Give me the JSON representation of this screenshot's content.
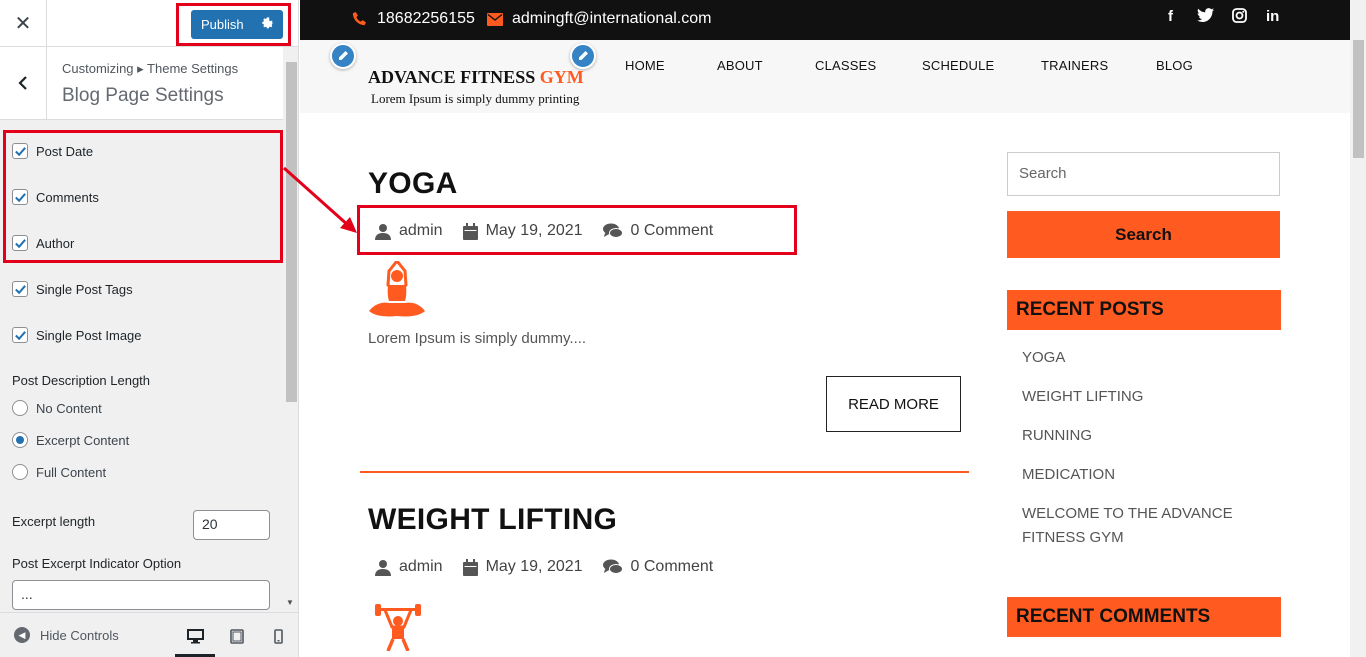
{
  "customizer": {
    "close_icon": "close-icon",
    "publish_label": "Publish",
    "breadcrumb": "Customizing ▸ Theme Settings",
    "section_title": "Blog Page Settings",
    "checkboxes": [
      {
        "label": "Post Date",
        "checked": true
      },
      {
        "label": "Comments",
        "checked": true
      },
      {
        "label": "Author",
        "checked": true
      },
      {
        "label": "Single Post Tags",
        "checked": true
      },
      {
        "label": "Single Post Image",
        "checked": true
      }
    ],
    "desc_length_label": "Post Description Length",
    "radios": [
      {
        "label": "No Content",
        "selected": false
      },
      {
        "label": "Excerpt Content",
        "selected": true
      },
      {
        "label": "Full Content",
        "selected": false
      }
    ],
    "excerpt_length_label": "Excerpt length",
    "excerpt_length_value": "20",
    "indicator_label": "Post Excerpt Indicator Option",
    "indicator_value": "...",
    "hide_controls_label": "Hide Controls",
    "accent_color": "#2271b1",
    "highlight_color": "#e3001b"
  },
  "site": {
    "phone": "18682256155",
    "email": "admingft@international.com",
    "logo_main": "ADVANCE FITNESS ",
    "logo_accent": "GYM",
    "tagline": "Lorem Ipsum is simply dummy printing",
    "nav": [
      "HOME",
      "ABOUT",
      "CLASSES",
      "SCHEDULE",
      "TRAINERS",
      "BLOG"
    ],
    "social_icons": [
      "facebook-icon",
      "twitter-icon",
      "instagram-icon",
      "linkedin-icon"
    ],
    "brand_color": "#ff5a1f",
    "posts": [
      {
        "title": "YOGA",
        "author": "admin",
        "date": "May 19, 2021",
        "comments": "0 Comment",
        "excerpt": "Lorem Ipsum is simply dummy....",
        "read_more": "READ MORE",
        "icon": "yoga-icon"
      },
      {
        "title": "WEIGHT LIFTING",
        "author": "admin",
        "date": "May 19, 2021",
        "comments": "0 Comment",
        "icon": "weightlifting-icon"
      }
    ],
    "sidebar": {
      "search_placeholder": "Search",
      "search_button": "Search",
      "recent_posts_title": "RECENT POSTS",
      "recent_posts": [
        "YOGA",
        "WEIGHT LIFTING",
        "RUNNING",
        "MEDICATION",
        "WELCOME TO THE ADVANCE FITNESS GYM"
      ],
      "recent_comments_title": "RECENT COMMENTS"
    }
  }
}
